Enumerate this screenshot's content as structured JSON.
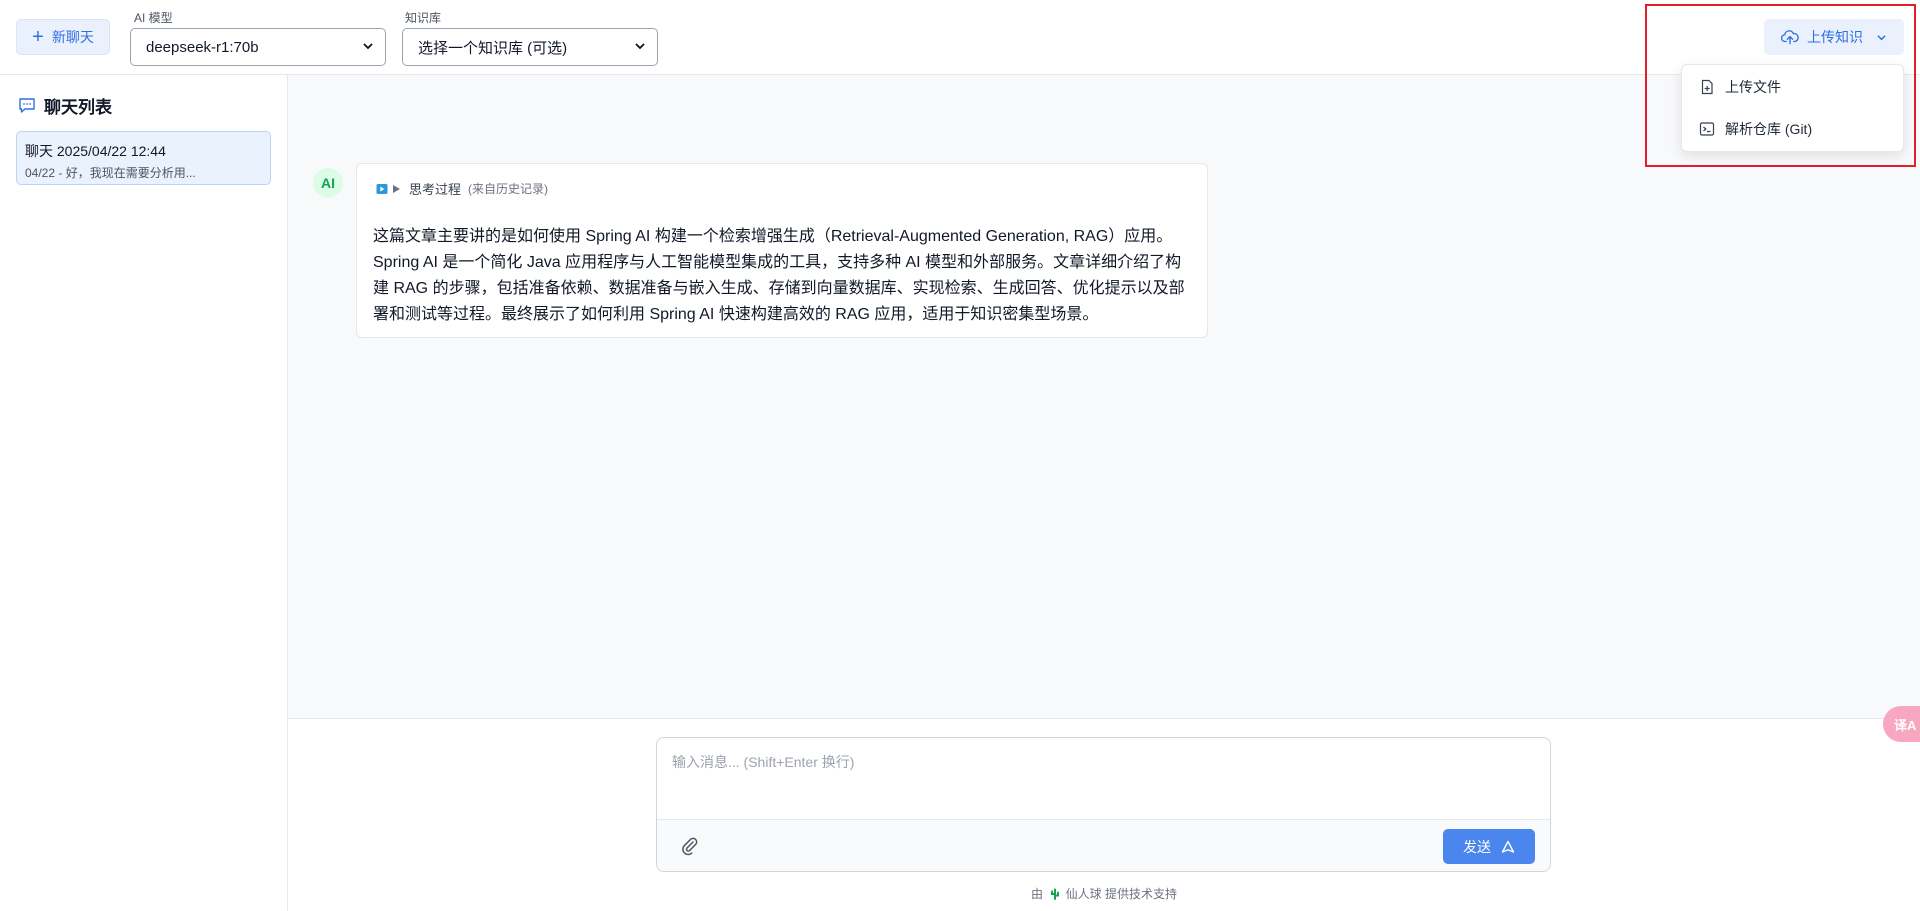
{
  "header": {
    "new_chat_label": "新聊天",
    "model_label": "AI 模型",
    "model_value": "deepseek-r1:70b",
    "kb_label": "知识库",
    "kb_value": "选择一个知识库 (可选)",
    "upload_label": "上传知识",
    "upload_menu": [
      {
        "label": "上传文件",
        "icon": "file-plus-icon"
      },
      {
        "label": "解析仓库 (Git)",
        "icon": "terminal-icon"
      }
    ]
  },
  "sidebar": {
    "title": "聊天列表",
    "chats": [
      {
        "title": "聊天 2025/04/22 12:44",
        "preview": "04/22 - 好，我现在需要分析用..."
      }
    ]
  },
  "message": {
    "avatar": "AI",
    "thinking_label": "思考过程",
    "thinking_sub": "(来自历史记录)",
    "text": "这篇文章主要讲的是如何使用 Spring AI 构建一个检索增强生成（Retrieval-Augmented Generation, RAG）应用。Spring AI 是一个简化 Java 应用程序与人工智能模型集成的工具，支持多种 AI 模型和外部服务。文章详细介绍了构建 RAG 的步骤，包括准备依赖、数据准备与嵌入生成、存储到向量数据库、实现检索、生成回答、优化提示以及部署和测试等过程。最终展示了如何利用 Spring AI 快速构建高效的 RAG 应用，适用于知识密集型场景。"
  },
  "composer": {
    "placeholder": "输入消息... (Shift+Enter 换行)",
    "value": "",
    "send_label": "发送"
  },
  "footer": {
    "prefix": "由",
    "brand": "仙人球",
    "suffix": "提供技术支持"
  },
  "float_button": {
    "label": "译A"
  },
  "colors": {
    "accent": "#2f6fe4",
    "send_button": "#4a86ee",
    "highlight": "#e11d2e",
    "avatar_bg": "#dcfce7"
  }
}
